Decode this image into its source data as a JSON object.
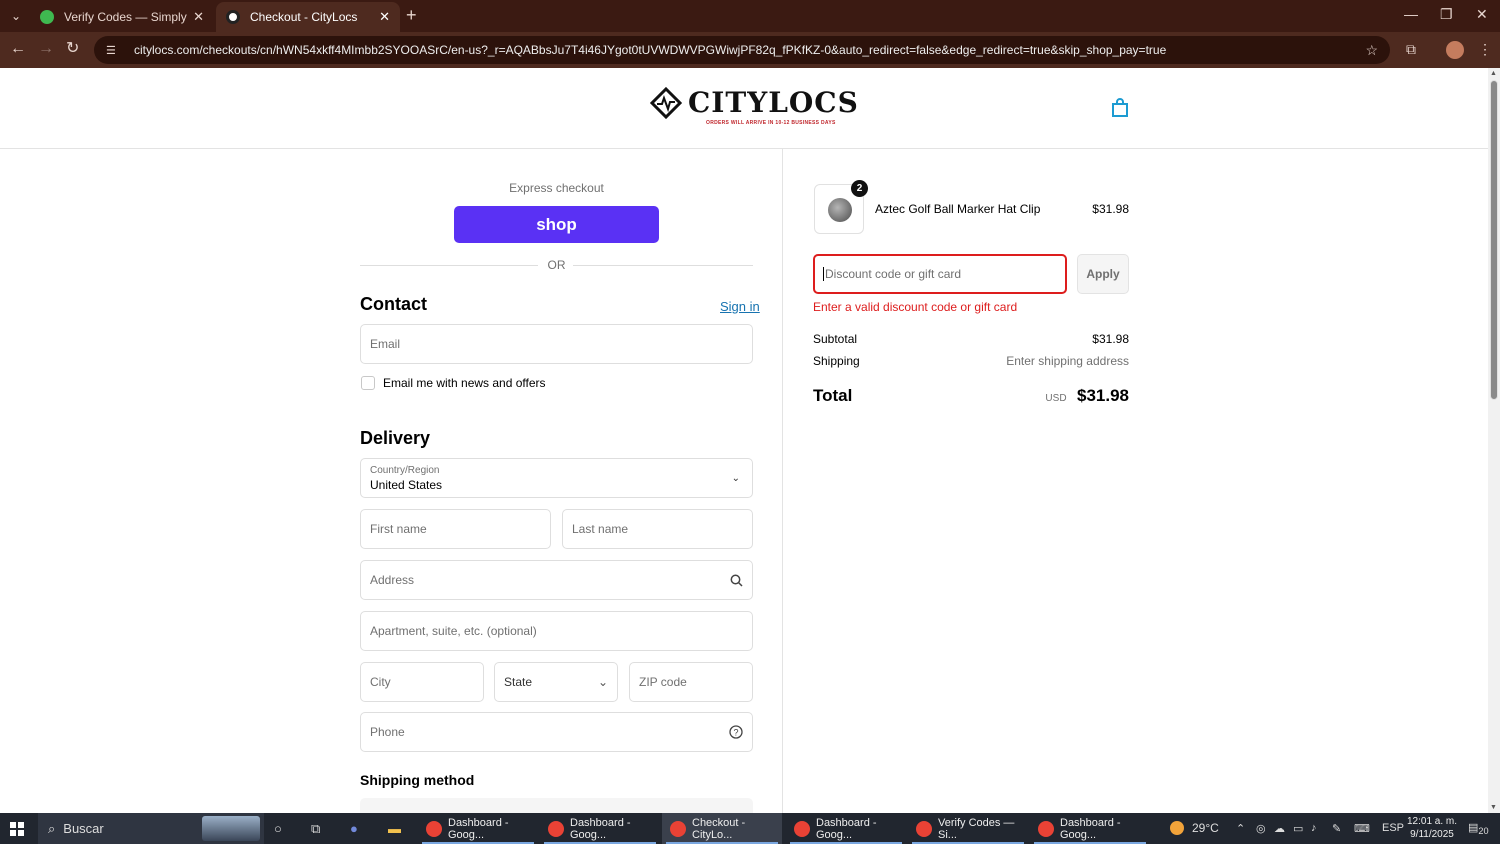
{
  "browser": {
    "tabs": [
      {
        "title": "Verify Codes — SimplyCodes",
        "favicon_color": "#3fb950"
      },
      {
        "title": "Checkout - CityLocs",
        "favicon_color": "#ffffff"
      }
    ],
    "url": "citylocs.com/checkouts/cn/hWN54xkff4MImbb2SYOOASrC/en-us?_r=AQABbsJu7T4i46JYgot0tUVWDWVPGWiwjPF82q_fPKfKZ-0&auto_redirect=false&edge_redirect=true&skip_shop_pay=true"
  },
  "header": {
    "logo_text": "CITYLOCS",
    "logo_subtitle": "ORDERS WILL ARRIVE IN 10-12 BUSINESS DAYS"
  },
  "checkout": {
    "express_label": "Express checkout",
    "shop_button": "shop",
    "or_label": "OR",
    "contact_heading": "Contact",
    "sign_in": "Sign in",
    "email_placeholder": "Email",
    "news_checkbox_label": "Email me with news and offers",
    "delivery_heading": "Delivery",
    "country_label": "Country/Region",
    "country_value": "United States",
    "first_name": "First name",
    "last_name": "Last name",
    "address": "Address",
    "apartment": "Apartment, suite, etc. (optional)",
    "city": "City",
    "state": "State",
    "zip": "ZIP code",
    "phone": "Phone",
    "shipping_method_heading": "Shipping method"
  },
  "summary": {
    "product": {
      "name": "Aztec Golf Ball Marker Hat Clip",
      "price": "$31.98",
      "quantity": "2"
    },
    "discount_placeholder": "Discount code or gift card",
    "apply_button": "Apply",
    "discount_error": "Enter a valid discount code or gift card",
    "subtotal_label": "Subtotal",
    "subtotal_value": "$31.98",
    "shipping_label": "Shipping",
    "shipping_value": "Enter shipping address",
    "total_label": "Total",
    "total_currency": "USD",
    "total_value": "$31.98"
  },
  "taskbar": {
    "search_placeholder": "Buscar",
    "apps": [
      {
        "label": "Dashboard - Goog...",
        "active": false
      },
      {
        "label": "Dashboard - Goog...",
        "active": false
      },
      {
        "label": "Checkout - CityLo...",
        "active": true
      },
      {
        "label": "Dashboard - Goog...",
        "active": false
      },
      {
        "label": "Verify Codes — Si...",
        "active": false
      },
      {
        "label": "Dashboard - Goog...",
        "active": false
      }
    ],
    "weather": "29°C",
    "language": "ESP",
    "time": "12:01 a. m.",
    "date": "9/11/2025",
    "notifications": "20"
  },
  "colors": {
    "accent_shop": "#5a31f4",
    "link": "#1773b0",
    "error": "#dd1d1d",
    "browser_frame": "#3b1a12"
  }
}
